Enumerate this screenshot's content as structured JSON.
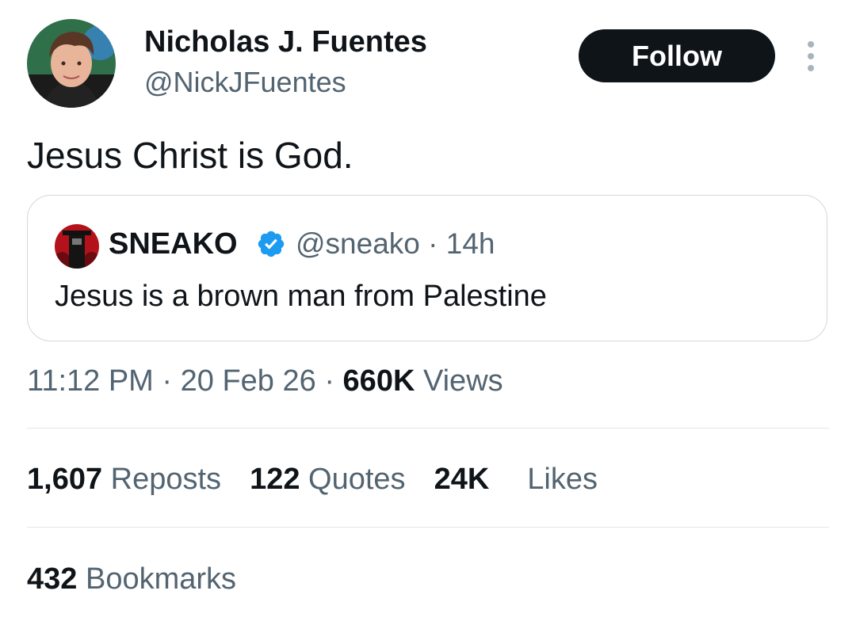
{
  "author": {
    "name": "Nicholas J. Fuentes",
    "handle": "@NickJFuentes",
    "follow_label": "Follow"
  },
  "tweet": {
    "text": "Jesus Christ is God."
  },
  "quoted": {
    "name": "SNEAKO",
    "verified": true,
    "handle": "@sneako",
    "time": "14h",
    "text": "Jesus is a brown man from Palestine"
  },
  "meta": {
    "time": "11:12 PM",
    "date": "20 Feb 26",
    "views_count": "660K",
    "views_label": "Views"
  },
  "stats": {
    "reposts_count": "1,607",
    "reposts_label": "Reposts",
    "quotes_count": "122",
    "quotes_label": "Quotes",
    "likes_count": "24K",
    "likes_label": "Likes",
    "bookmarks_count": "432",
    "bookmarks_label": "Bookmarks"
  },
  "colors": {
    "primary_text": "#0f1419",
    "secondary_text": "#536471",
    "verified_blue": "#1d9bf0",
    "follow_bg": "#0f1419"
  },
  "icons": [
    "more-vertical-icon",
    "verified-badge-icon"
  ]
}
